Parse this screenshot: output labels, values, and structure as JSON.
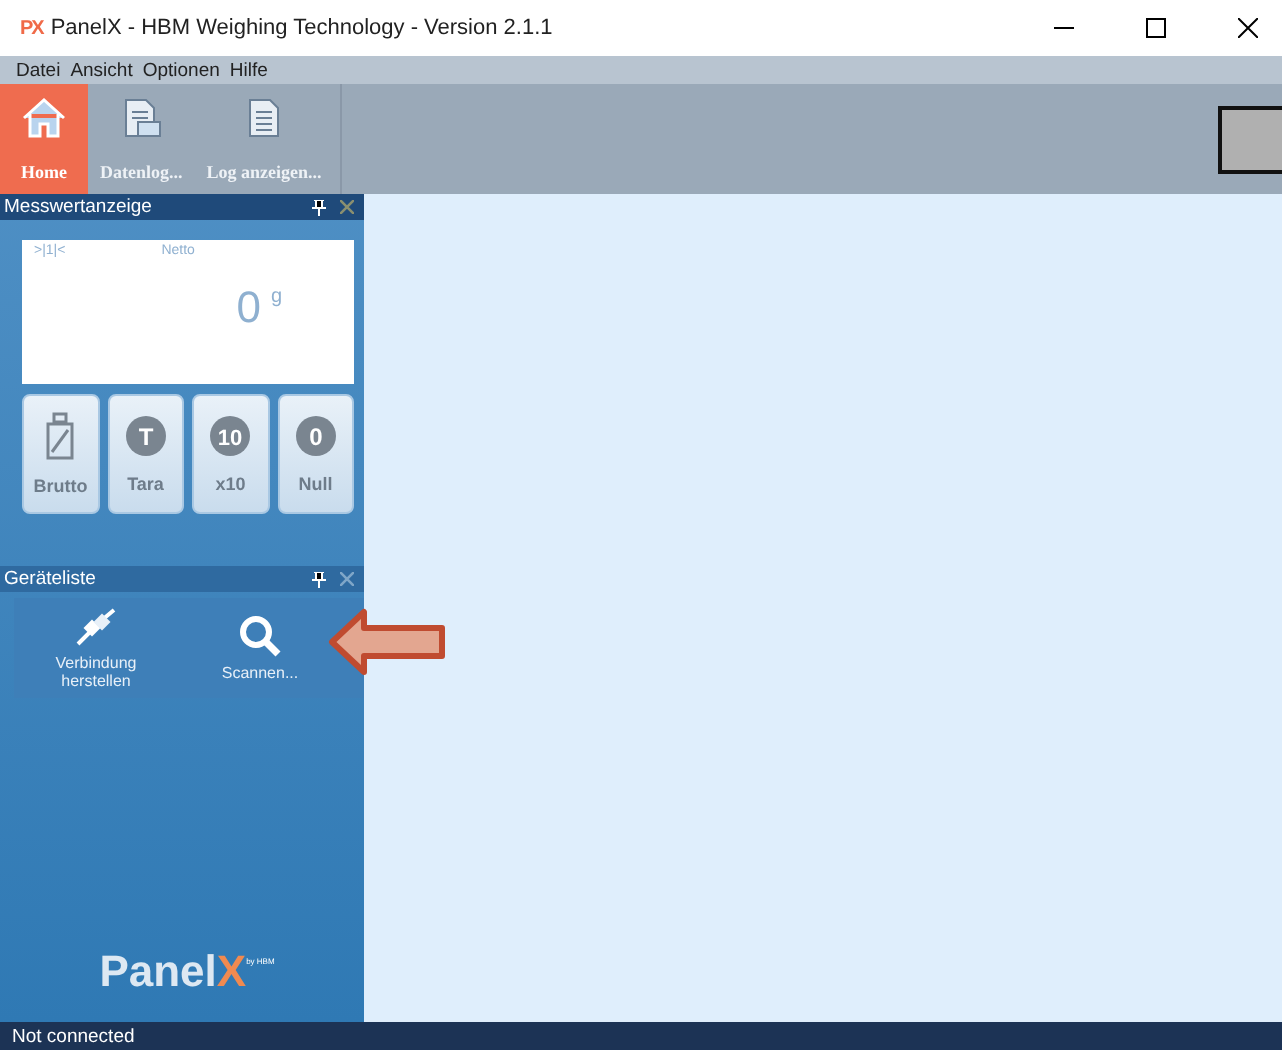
{
  "window": {
    "app_mark": "PX",
    "title": "PanelX - HBM Weighing Technology - Version 2.1.1"
  },
  "menu": [
    "Datei",
    "Ansicht",
    "Optionen",
    "Hilfe"
  ],
  "ribbon": [
    {
      "label": "Home",
      "kind": "home",
      "selected": true
    },
    {
      "label": "Datenlog...",
      "kind": "datalog",
      "selected": false
    },
    {
      "label": "Log anzeigen...",
      "kind": "log",
      "selected": false
    }
  ],
  "measurement_panel": {
    "title": "Messwertanzeige",
    "display": {
      "range": ">|1|<",
      "mode": "Netto",
      "value": "0",
      "unit": "g"
    },
    "buttons": [
      {
        "label": "Brutto",
        "kind": "weight"
      },
      {
        "label": "Tara",
        "kind": "tara",
        "symbol": "T"
      },
      {
        "label": "x10",
        "kind": "x10",
        "symbol": "10"
      },
      {
        "label": "Null",
        "kind": "zero",
        "symbol": "0"
      }
    ]
  },
  "device_panel": {
    "title": "Geräteliste",
    "buttons": [
      {
        "label": "Verbindung herstellen",
        "kind": "plug"
      },
      {
        "label": "Scannen...",
        "kind": "search"
      }
    ]
  },
  "logo": {
    "text": "Panel",
    "mark": "X",
    "tagline": "by HBM"
  },
  "status_bar": "Not connected"
}
